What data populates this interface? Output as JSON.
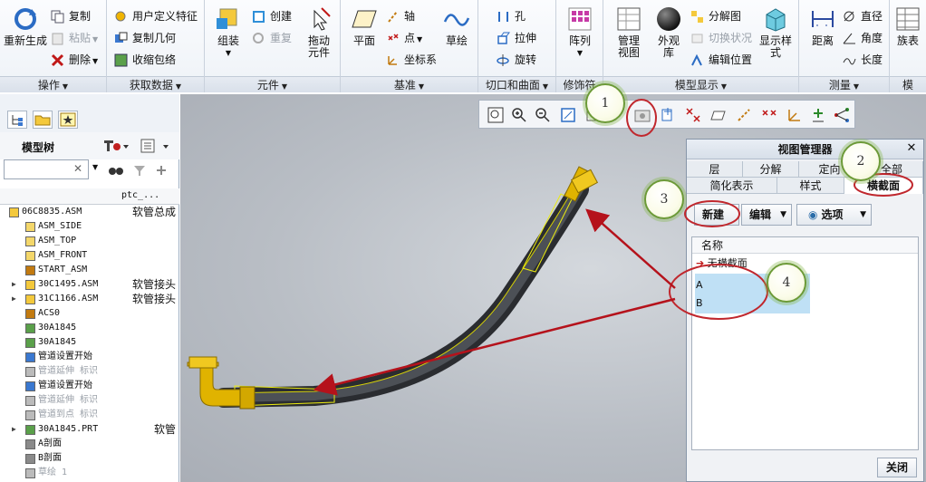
{
  "ribbon": {
    "groups": [
      {
        "label": "操作"
      },
      {
        "label": "获取数据"
      },
      {
        "label": "元件"
      },
      {
        "label": "基准"
      },
      {
        "label": "切口和曲面"
      },
      {
        "label": "修饰符"
      },
      {
        "label": "模型显示"
      },
      {
        "label": "测量"
      },
      {
        "label": "模"
      }
    ],
    "ops": {
      "regenerate": "重新生成",
      "copy": "复制",
      "paste": "粘贴",
      "delete": "删除"
    },
    "getdata": {
      "udf": "用户定义特征",
      "copy_geom": "复制几何",
      "shrinkwrap": "收缩包络"
    },
    "component": {
      "assemble": "组装",
      "create": "创建",
      "repeat": "重复",
      "drag": "拖动元件"
    },
    "datum": {
      "plane": "平面",
      "axis": "轴",
      "point": "点",
      "csys": "坐标系",
      "sketch": "草绘"
    },
    "cut": {
      "hole": "孔",
      "extrude": "拉伸",
      "revolve": "旋转"
    },
    "modifier": {
      "pattern": "阵列"
    },
    "display": {
      "view_manager": "管理视图",
      "appearance": "外观库",
      "exploded": "分解图",
      "toggle_state": "切换状况",
      "edit_position": "编辑位置",
      "display_style": "显示样式"
    },
    "measure": {
      "distance": "距离",
      "diameter": "直径",
      "angle": "角度",
      "length": "长度"
    },
    "family": {
      "table": "族表"
    }
  },
  "tree": {
    "title": "模型树",
    "col2_header": "ptc_...",
    "rows": [
      {
        "name": "06C8835.ASM",
        "col2": "软管总成",
        "style": "normal"
      },
      {
        "name": "ASM_SIDE",
        "col2": "",
        "style": "normal"
      },
      {
        "name": "ASM_TOP",
        "col2": "",
        "style": "normal"
      },
      {
        "name": "ASM_FRONT",
        "col2": "",
        "style": "normal"
      },
      {
        "name": "START_ASM",
        "col2": "",
        "style": "normal"
      },
      {
        "name": "30C1495.ASM",
        "col2": "软管接头",
        "style": "normal"
      },
      {
        "name": "31C1166.ASM",
        "col2": "软管接头",
        "style": "normal"
      },
      {
        "name": "ACS0",
        "col2": "",
        "style": "normal"
      },
      {
        "name": "30A1845",
        "col2": "",
        "style": "normal"
      },
      {
        "name": "30A1845",
        "col2": "",
        "style": "normal"
      },
      {
        "name": "管道设置开始",
        "col2": "",
        "style": "normal"
      },
      {
        "name": "管道延伸 标识",
        "col2": "",
        "style": "gray"
      },
      {
        "name": "管道设置开始",
        "col2": "",
        "style": "normal"
      },
      {
        "name": "管道延伸 标识",
        "col2": "",
        "style": "gray"
      },
      {
        "name": "管道到点 标识",
        "col2": "",
        "style": "gray"
      },
      {
        "name": "30A1845.PRT",
        "col2": "软管",
        "style": "normal"
      },
      {
        "name": "A剖面",
        "col2": "",
        "style": "normal"
      },
      {
        "name": "B剖面",
        "col2": "",
        "style": "normal"
      },
      {
        "name": "草绘 1",
        "col2": "",
        "style": "gray"
      }
    ]
  },
  "view_manager": {
    "title": "视图管理器",
    "tabs_row1": [
      "层",
      "分解",
      "定向",
      "全部"
    ],
    "tabs_row2": [
      "简化表示",
      "样式",
      "横截面"
    ],
    "active_tab": "横截面",
    "new_button": "新建",
    "edit_button": "编辑",
    "options_button": "选项",
    "list_header": "名称",
    "items": [
      "无横截面",
      "A",
      "B"
    ],
    "close_button": "关闭"
  },
  "callouts": [
    "1",
    "2",
    "3",
    "4"
  ],
  "colors": {
    "callout_ring": "#c0272d",
    "arrow": "#b5121b",
    "hose": "#3c3f44",
    "fitting": "#e0b300"
  }
}
